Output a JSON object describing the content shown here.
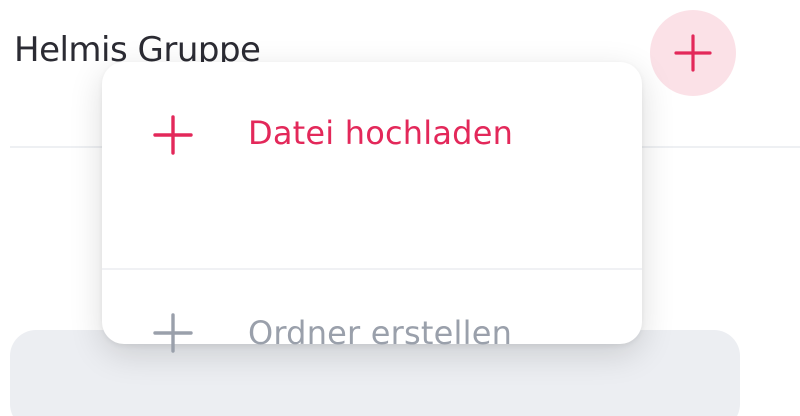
{
  "header": {
    "title": "Helmis Gruppe"
  },
  "add_menu": {
    "items": [
      {
        "label": "Datei hochladen",
        "icon": "plus-icon",
        "color": "#e3285a"
      },
      {
        "label": "Ordner erstellen",
        "icon": "plus-icon",
        "color": "#9aa0ab"
      }
    ]
  },
  "colors": {
    "accent": "#e3285a",
    "accent_soft": "#fbe1e7",
    "muted": "#9aa0ab",
    "text": "#2b2b33"
  }
}
